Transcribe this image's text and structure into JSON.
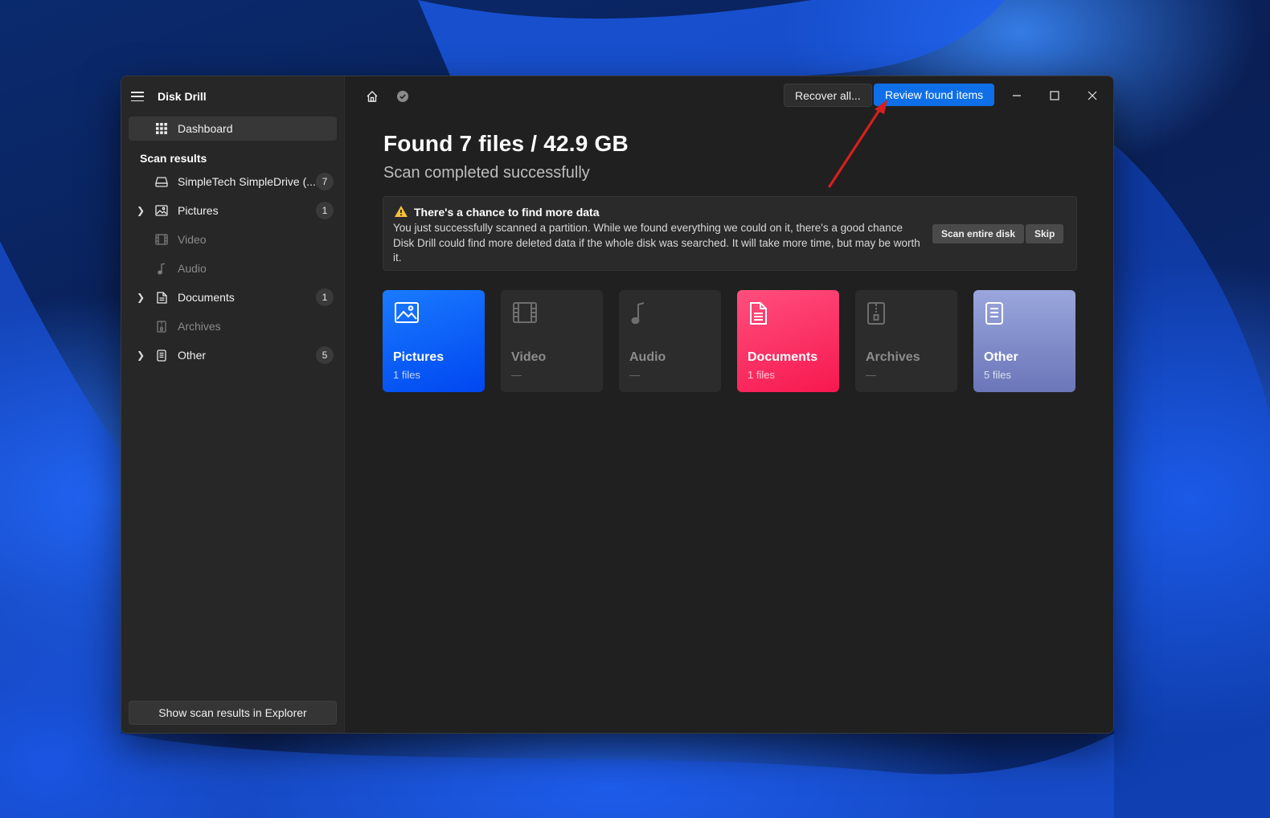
{
  "app": {
    "title": "Disk Drill"
  },
  "sidebar": {
    "dashboard_label": "Dashboard",
    "section_label": "Scan results",
    "items": [
      {
        "label": "SimpleTech SimpleDrive (...",
        "count": "7",
        "icon": "drive-icon",
        "expandable": false,
        "dim": false
      },
      {
        "label": "Pictures",
        "count": "1",
        "icon": "image-icon",
        "expandable": true,
        "dim": false
      },
      {
        "label": "Video",
        "count": "",
        "icon": "film-icon",
        "expandable": false,
        "dim": true
      },
      {
        "label": "Audio",
        "count": "",
        "icon": "music-note-icon",
        "expandable": false,
        "dim": true
      },
      {
        "label": "Documents",
        "count": "1",
        "icon": "document-icon",
        "expandable": true,
        "dim": false
      },
      {
        "label": "Archives",
        "count": "",
        "icon": "archive-icon",
        "expandable": false,
        "dim": true
      },
      {
        "label": "Other",
        "count": "5",
        "icon": "file-icon",
        "expandable": true,
        "dim": false
      }
    ],
    "footer_button": "Show scan results in Explorer"
  },
  "toolbar": {
    "recover_all_label": "Recover all...",
    "review_label": "Review found items",
    "review_color": "#0f6fe8"
  },
  "main": {
    "headline": "Found 7 files / 42.9 GB",
    "subline": "Scan completed successfully",
    "notice": {
      "title": "There's a chance to find more data",
      "text": "You just successfully scanned a partition. While we found everything we could on it, there's a good chance Disk Drill could find more deleted data if the whole disk was searched. It will take more time, but may be worth it.",
      "scan_button": "Scan entire disk",
      "skip_button": "Skip"
    },
    "cards": [
      {
        "title": "Pictures",
        "sub": "1 files",
        "icon": "image-icon",
        "style": "pictures"
      },
      {
        "title": "Video",
        "sub": "—",
        "icon": "film-icon",
        "style": "dim"
      },
      {
        "title": "Audio",
        "sub": "—",
        "icon": "music-note-icon",
        "style": "dim"
      },
      {
        "title": "Documents",
        "sub": "1 files",
        "icon": "document-icon",
        "style": "documents"
      },
      {
        "title": "Archives",
        "sub": "—",
        "icon": "archive-icon",
        "style": "dim"
      },
      {
        "title": "Other",
        "sub": "5 files",
        "icon": "file-icon",
        "style": "other"
      }
    ]
  },
  "colors": {
    "pictures": "#0046f0",
    "documents": "#f7184f",
    "other": "#7a86c6",
    "annotation_arrow": "#d42020"
  }
}
